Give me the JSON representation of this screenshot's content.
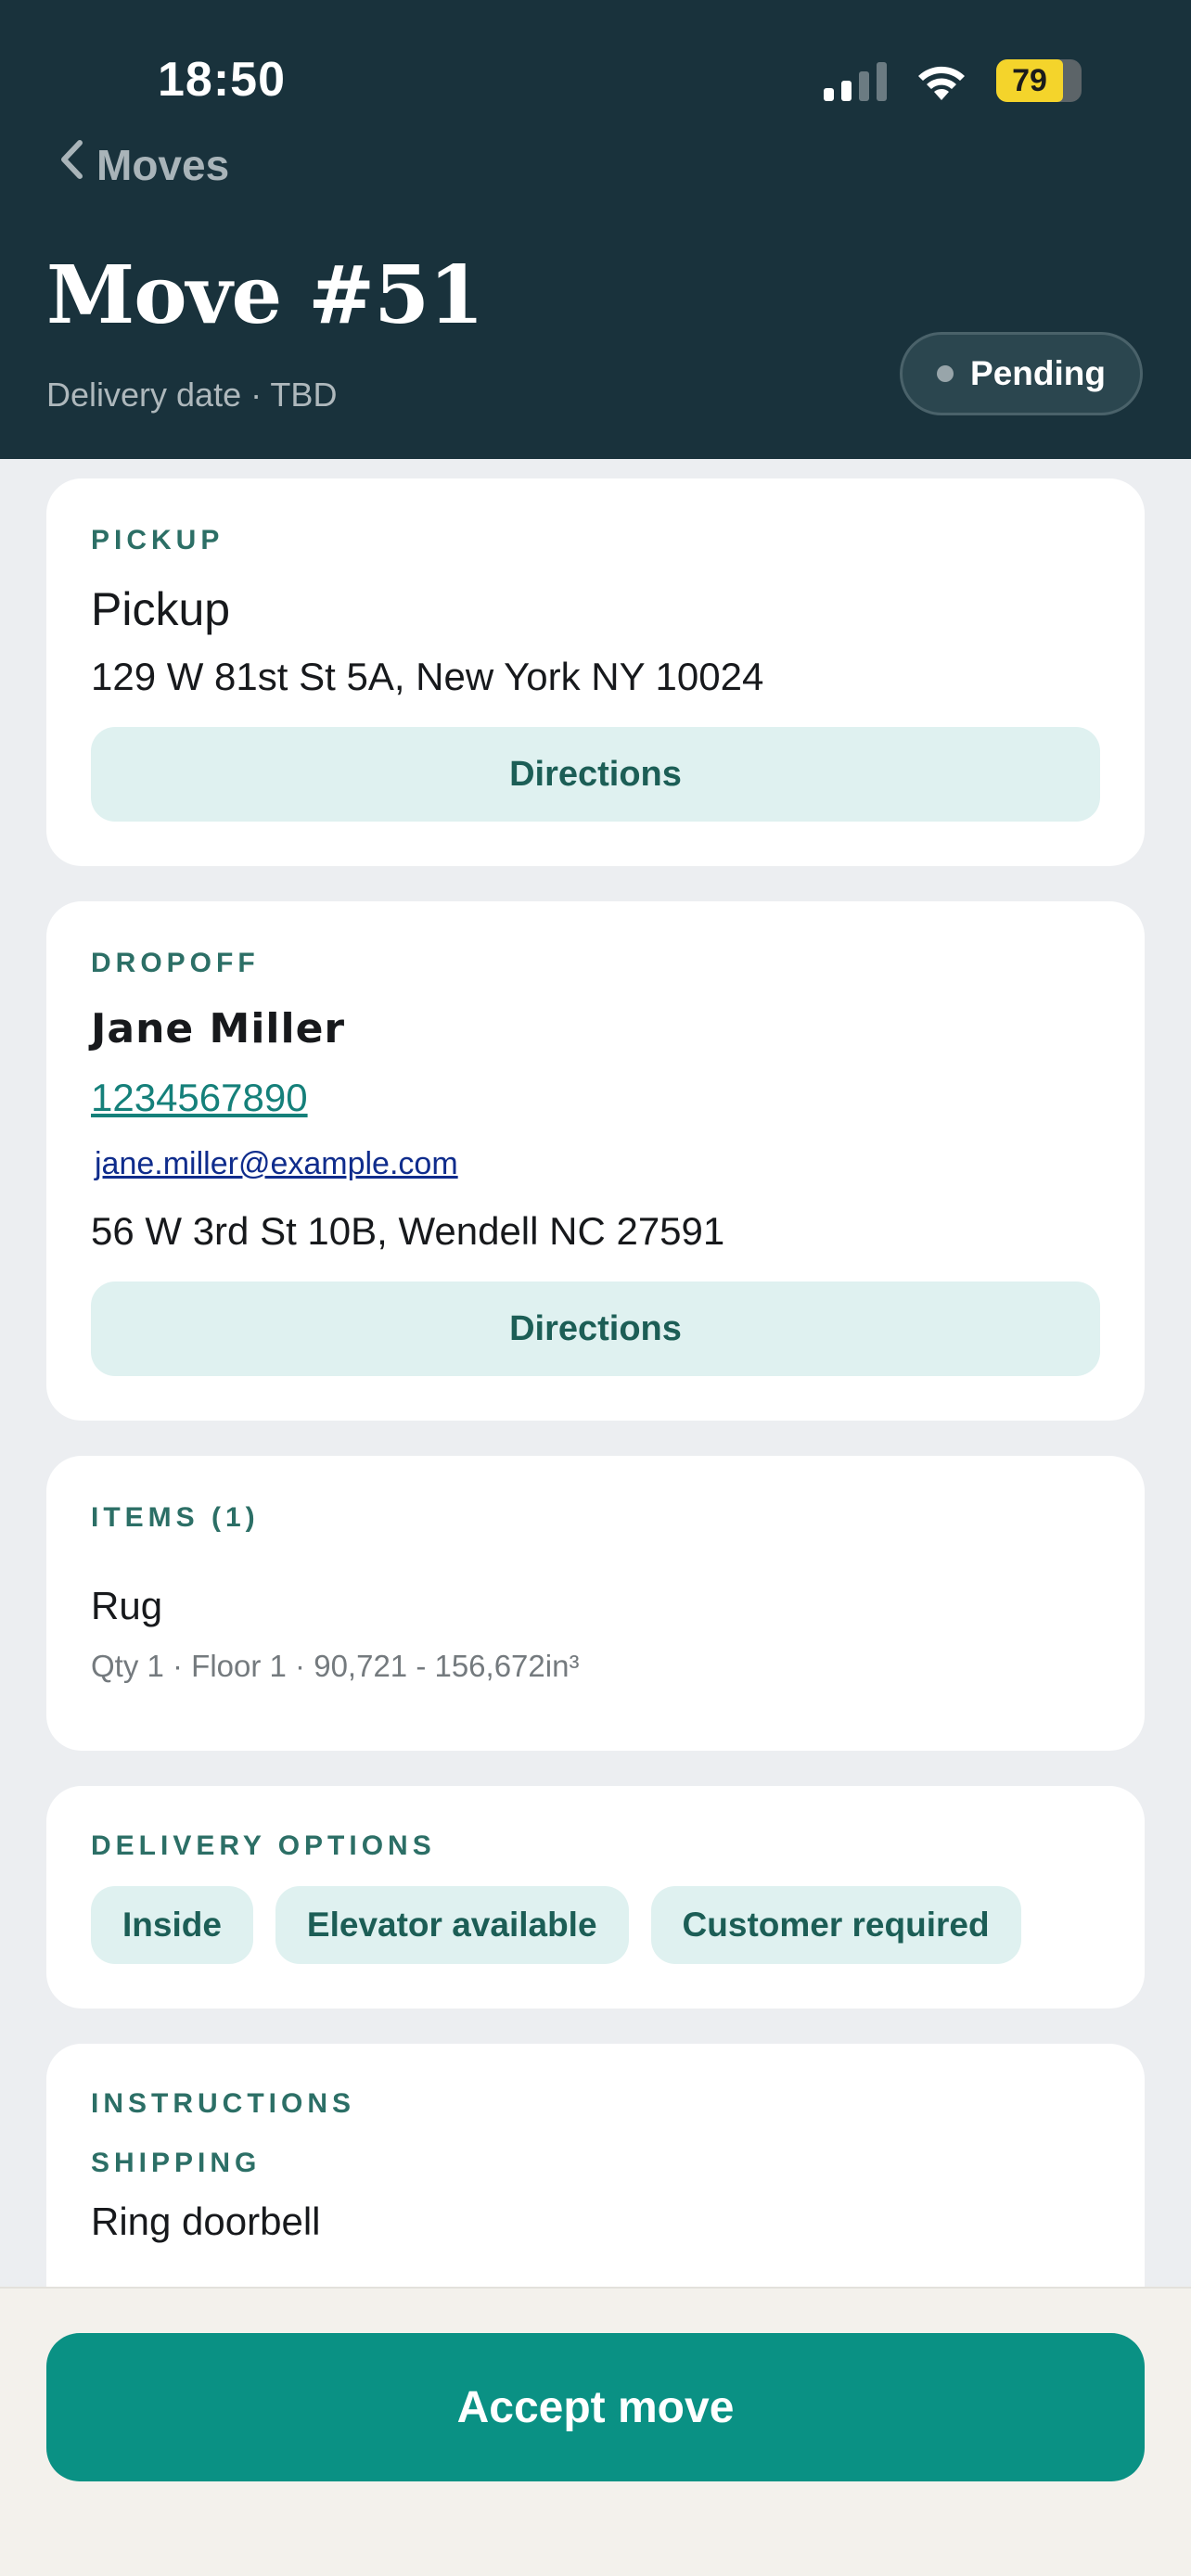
{
  "status_bar": {
    "time": "18:50",
    "battery": "79"
  },
  "nav": {
    "back_label": "Moves"
  },
  "header": {
    "title": "Move #51",
    "subtitle": "Delivery date · TBD",
    "status": "Pending"
  },
  "pickup": {
    "section_label": "PICKUP",
    "name": "Pickup",
    "address": "129 W 81st St 5A, New York NY 10024",
    "directions_label": "Directions"
  },
  "dropoff": {
    "section_label": "DROPOFF",
    "name": "Jane Miller",
    "phone": "1234567890",
    "email": "jane.miller@example.com",
    "address": "56 W 3rd St 10B, Wendell NC 27591",
    "directions_label": "Directions"
  },
  "items": {
    "section_label": "ITEMS (1)",
    "list": [
      {
        "name": "Rug",
        "details": "Qty 1 · Floor 1 · 90,721 - 156,672in³"
      }
    ]
  },
  "delivery_options": {
    "section_label": "DELIVERY OPTIONS",
    "chips": [
      "Inside",
      "Elevator available",
      "Customer required"
    ]
  },
  "instructions": {
    "section_label": "INSTRUCTIONS",
    "sub_label": "SHIPPING",
    "text": "Ring doorbell"
  },
  "footer": {
    "accept_label": "Accept move"
  },
  "colors": {
    "header_bg": "#19323c",
    "accent": "#0a9184",
    "chip_bg": "#dff1f0",
    "label": "#2c6f66"
  },
  "icons": [
    "chevron-left-icon",
    "signal-icon",
    "wifi-icon",
    "battery-icon",
    "status-dot-icon"
  ]
}
